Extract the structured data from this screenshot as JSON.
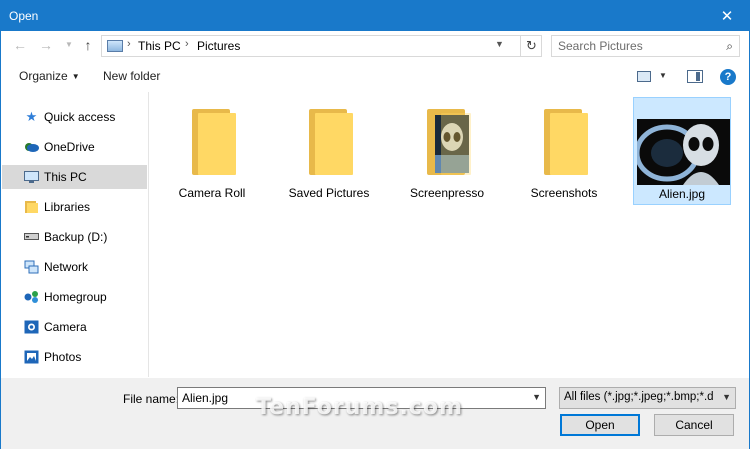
{
  "window": {
    "title": "Open",
    "accent_color": "#1979ca",
    "close_icon": "close-icon"
  },
  "navigation": {
    "back_icon": "back-arrow-icon",
    "forward_icon": "forward-arrow-icon",
    "recent_icon": "chevron-down-icon",
    "up_icon": "up-arrow-icon",
    "breadcrumb": [
      "This PC",
      "Pictures"
    ],
    "refresh_icon": "refresh-icon",
    "search_placeholder": "Search Pictures"
  },
  "toolbar": {
    "organize_label": "Organize",
    "new_folder_label": "New folder"
  },
  "sidebar": {
    "items": [
      {
        "label": "Quick access",
        "icon": "star-icon",
        "selected": false
      },
      {
        "label": "OneDrive",
        "icon": "cloud-icon",
        "selected": false
      },
      {
        "label": "This PC",
        "icon": "computer-icon",
        "selected": true
      },
      {
        "label": "Libraries",
        "icon": "library-icon",
        "selected": false
      },
      {
        "label": "Backup (D:)",
        "icon": "drive-icon",
        "selected": false
      },
      {
        "label": "Network",
        "icon": "network-icon",
        "selected": false
      },
      {
        "label": "Homegroup",
        "icon": "homegroup-icon",
        "selected": false
      },
      {
        "label": "Camera",
        "icon": "camera-icon",
        "selected": false
      },
      {
        "label": "Photos",
        "icon": "photos-icon",
        "selected": false
      }
    ]
  },
  "files": [
    {
      "name": "Camera Roll",
      "type": "folder",
      "selected": false
    },
    {
      "name": "Saved Pictures",
      "type": "folder",
      "selected": false
    },
    {
      "name": "Screenpresso",
      "type": "folder-with-preview",
      "selected": false
    },
    {
      "name": "Screenshots",
      "type": "folder",
      "selected": false
    },
    {
      "name": "Alien.jpg",
      "type": "image",
      "selected": true
    }
  ],
  "footer": {
    "file_name_label": "File name:",
    "file_name_value": "Alien.jpg",
    "filter_value": "All files (*.jpg;*.jpeg;*.bmp;*.dil",
    "open_label": "Open",
    "cancel_label": "Cancel",
    "watermark": "TenForums.com"
  }
}
